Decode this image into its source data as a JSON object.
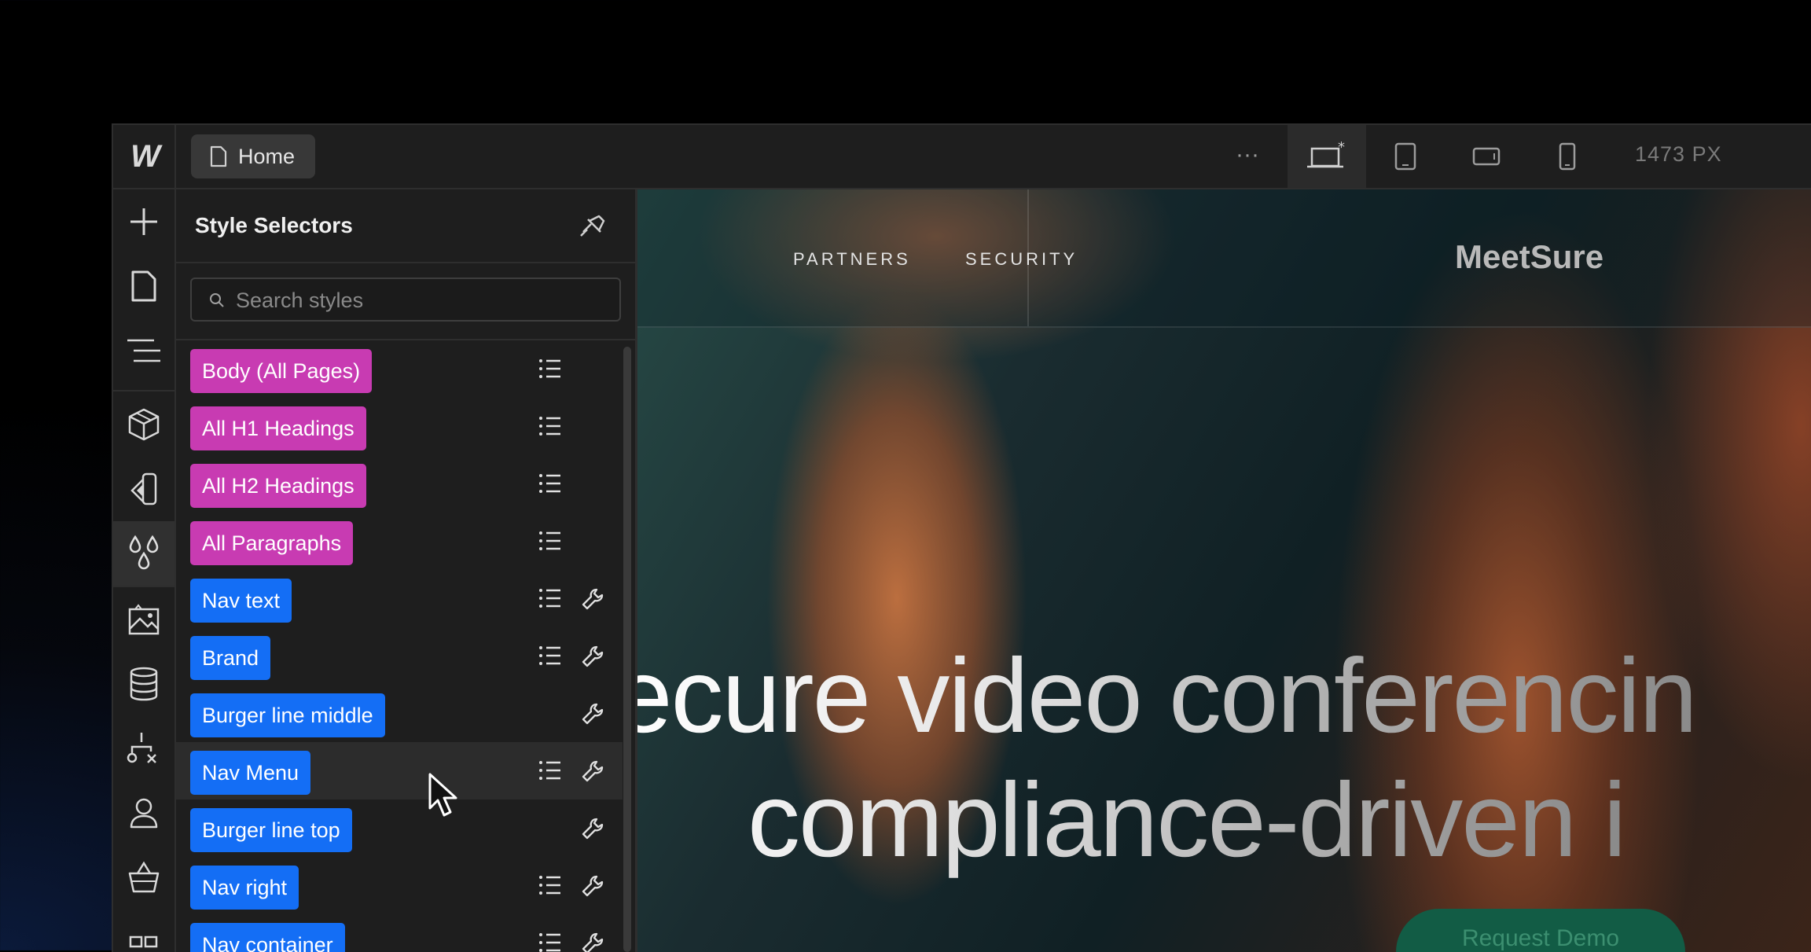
{
  "app": {
    "logo_text": "W",
    "page_chip": {
      "label": "Home",
      "icon": "page-icon"
    },
    "toolbar": {
      "more_icon": "ellipsis-icon",
      "more_label": "···",
      "breakpoints": [
        "desktop-base-icon",
        "tablet-icon",
        "mobile-landscape-icon",
        "mobile-portrait-icon"
      ],
      "width_readout": "1473 PX"
    },
    "rail": [
      "add-icon",
      "pages-icon",
      "navigator-icon",
      "components-icon",
      "style-guide-icon",
      "style-selectors-icon",
      "assets-icon",
      "cms-icon",
      "logic-icon",
      "users-icon",
      "ecommerce-icon",
      "apps-icon"
    ]
  },
  "panel": {
    "title": "Style Selectors",
    "search_placeholder": "Search styles",
    "selectors": [
      {
        "label": "Body (All Pages)",
        "kind": "tag",
        "color": "#c83bb2",
        "list": true,
        "wrench": false
      },
      {
        "label": "All H1 Headings",
        "kind": "tag",
        "color": "#c83bb2",
        "list": true,
        "wrench": false
      },
      {
        "label": "All H2 Headings",
        "kind": "tag",
        "color": "#c83bb2",
        "list": true,
        "wrench": false
      },
      {
        "label": "All Paragraphs",
        "kind": "tag",
        "color": "#c83bb2",
        "list": true,
        "wrench": false
      },
      {
        "label": "Nav text",
        "kind": "class",
        "color": "#146ef5",
        "list": true,
        "wrench": true
      },
      {
        "label": "Brand",
        "kind": "class",
        "color": "#146ef5",
        "list": true,
        "wrench": true
      },
      {
        "label": "Burger line middle",
        "kind": "class",
        "color": "#146ef5",
        "list": false,
        "wrench": true
      },
      {
        "label": "Nav Menu",
        "kind": "class",
        "color": "#146ef5",
        "list": true,
        "wrench": true
      },
      {
        "label": "Burger line top",
        "kind": "class",
        "color": "#146ef5",
        "list": false,
        "wrench": true
      },
      {
        "label": "Nav right",
        "kind": "class",
        "color": "#146ef5",
        "list": true,
        "wrench": true
      },
      {
        "label": "Nav container",
        "kind": "class",
        "color": "#146ef5",
        "list": true,
        "wrench": true
      }
    ]
  },
  "canvas": {
    "nav_links": [
      "PARTNERS",
      "SECURITY"
    ],
    "brand": "MeetSure",
    "hero_line_1": "ecure video conferencin",
    "hero_line_2": "compliance-driven i",
    "cta_label": "Request Demo"
  }
}
